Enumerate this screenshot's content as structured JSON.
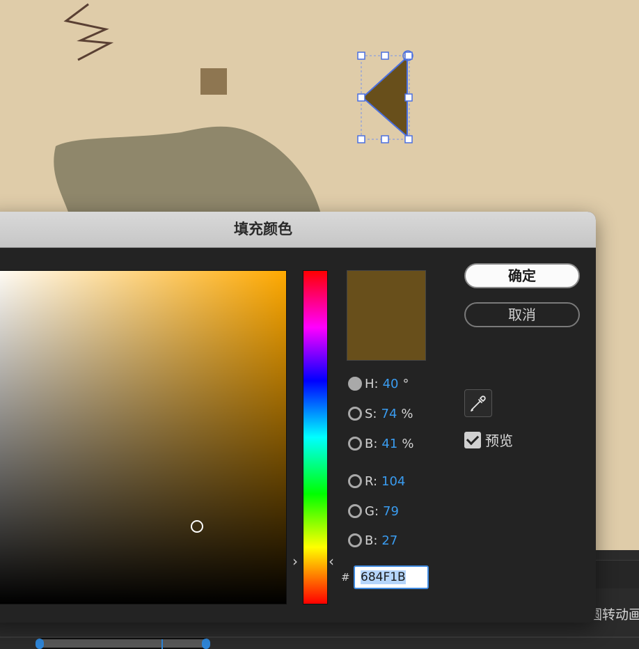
{
  "dialog": {
    "title": "填充颜色",
    "ok_label": "确定",
    "cancel_label": "取消",
    "preview_label": "预览",
    "preview_checked": true,
    "current_color": "#684f1b"
  },
  "fields": {
    "h": {
      "label": "H:",
      "value": "40",
      "unit": "°"
    },
    "s": {
      "label": "S:",
      "value": "74",
      "unit": "%"
    },
    "b": {
      "label": "B:",
      "value": "41",
      "unit": "%"
    },
    "r": {
      "label": "R:",
      "value": "104"
    },
    "g": {
      "label": "G:",
      "value": "79"
    },
    "bb": {
      "label": "B:",
      "value": "27"
    }
  },
  "hex": {
    "hash": "#",
    "value": "684F1B"
  },
  "background_app": {
    "layer_label": "圆转动画"
  },
  "colors": {
    "canvas": "#dfcca9",
    "shape_fill": "#8b8166",
    "triangle_fill": "#684f1b",
    "selection": "#4a6fe0",
    "accent": "#3a9cf0"
  },
  "icons": {
    "eyedropper": "eyedropper-icon"
  }
}
